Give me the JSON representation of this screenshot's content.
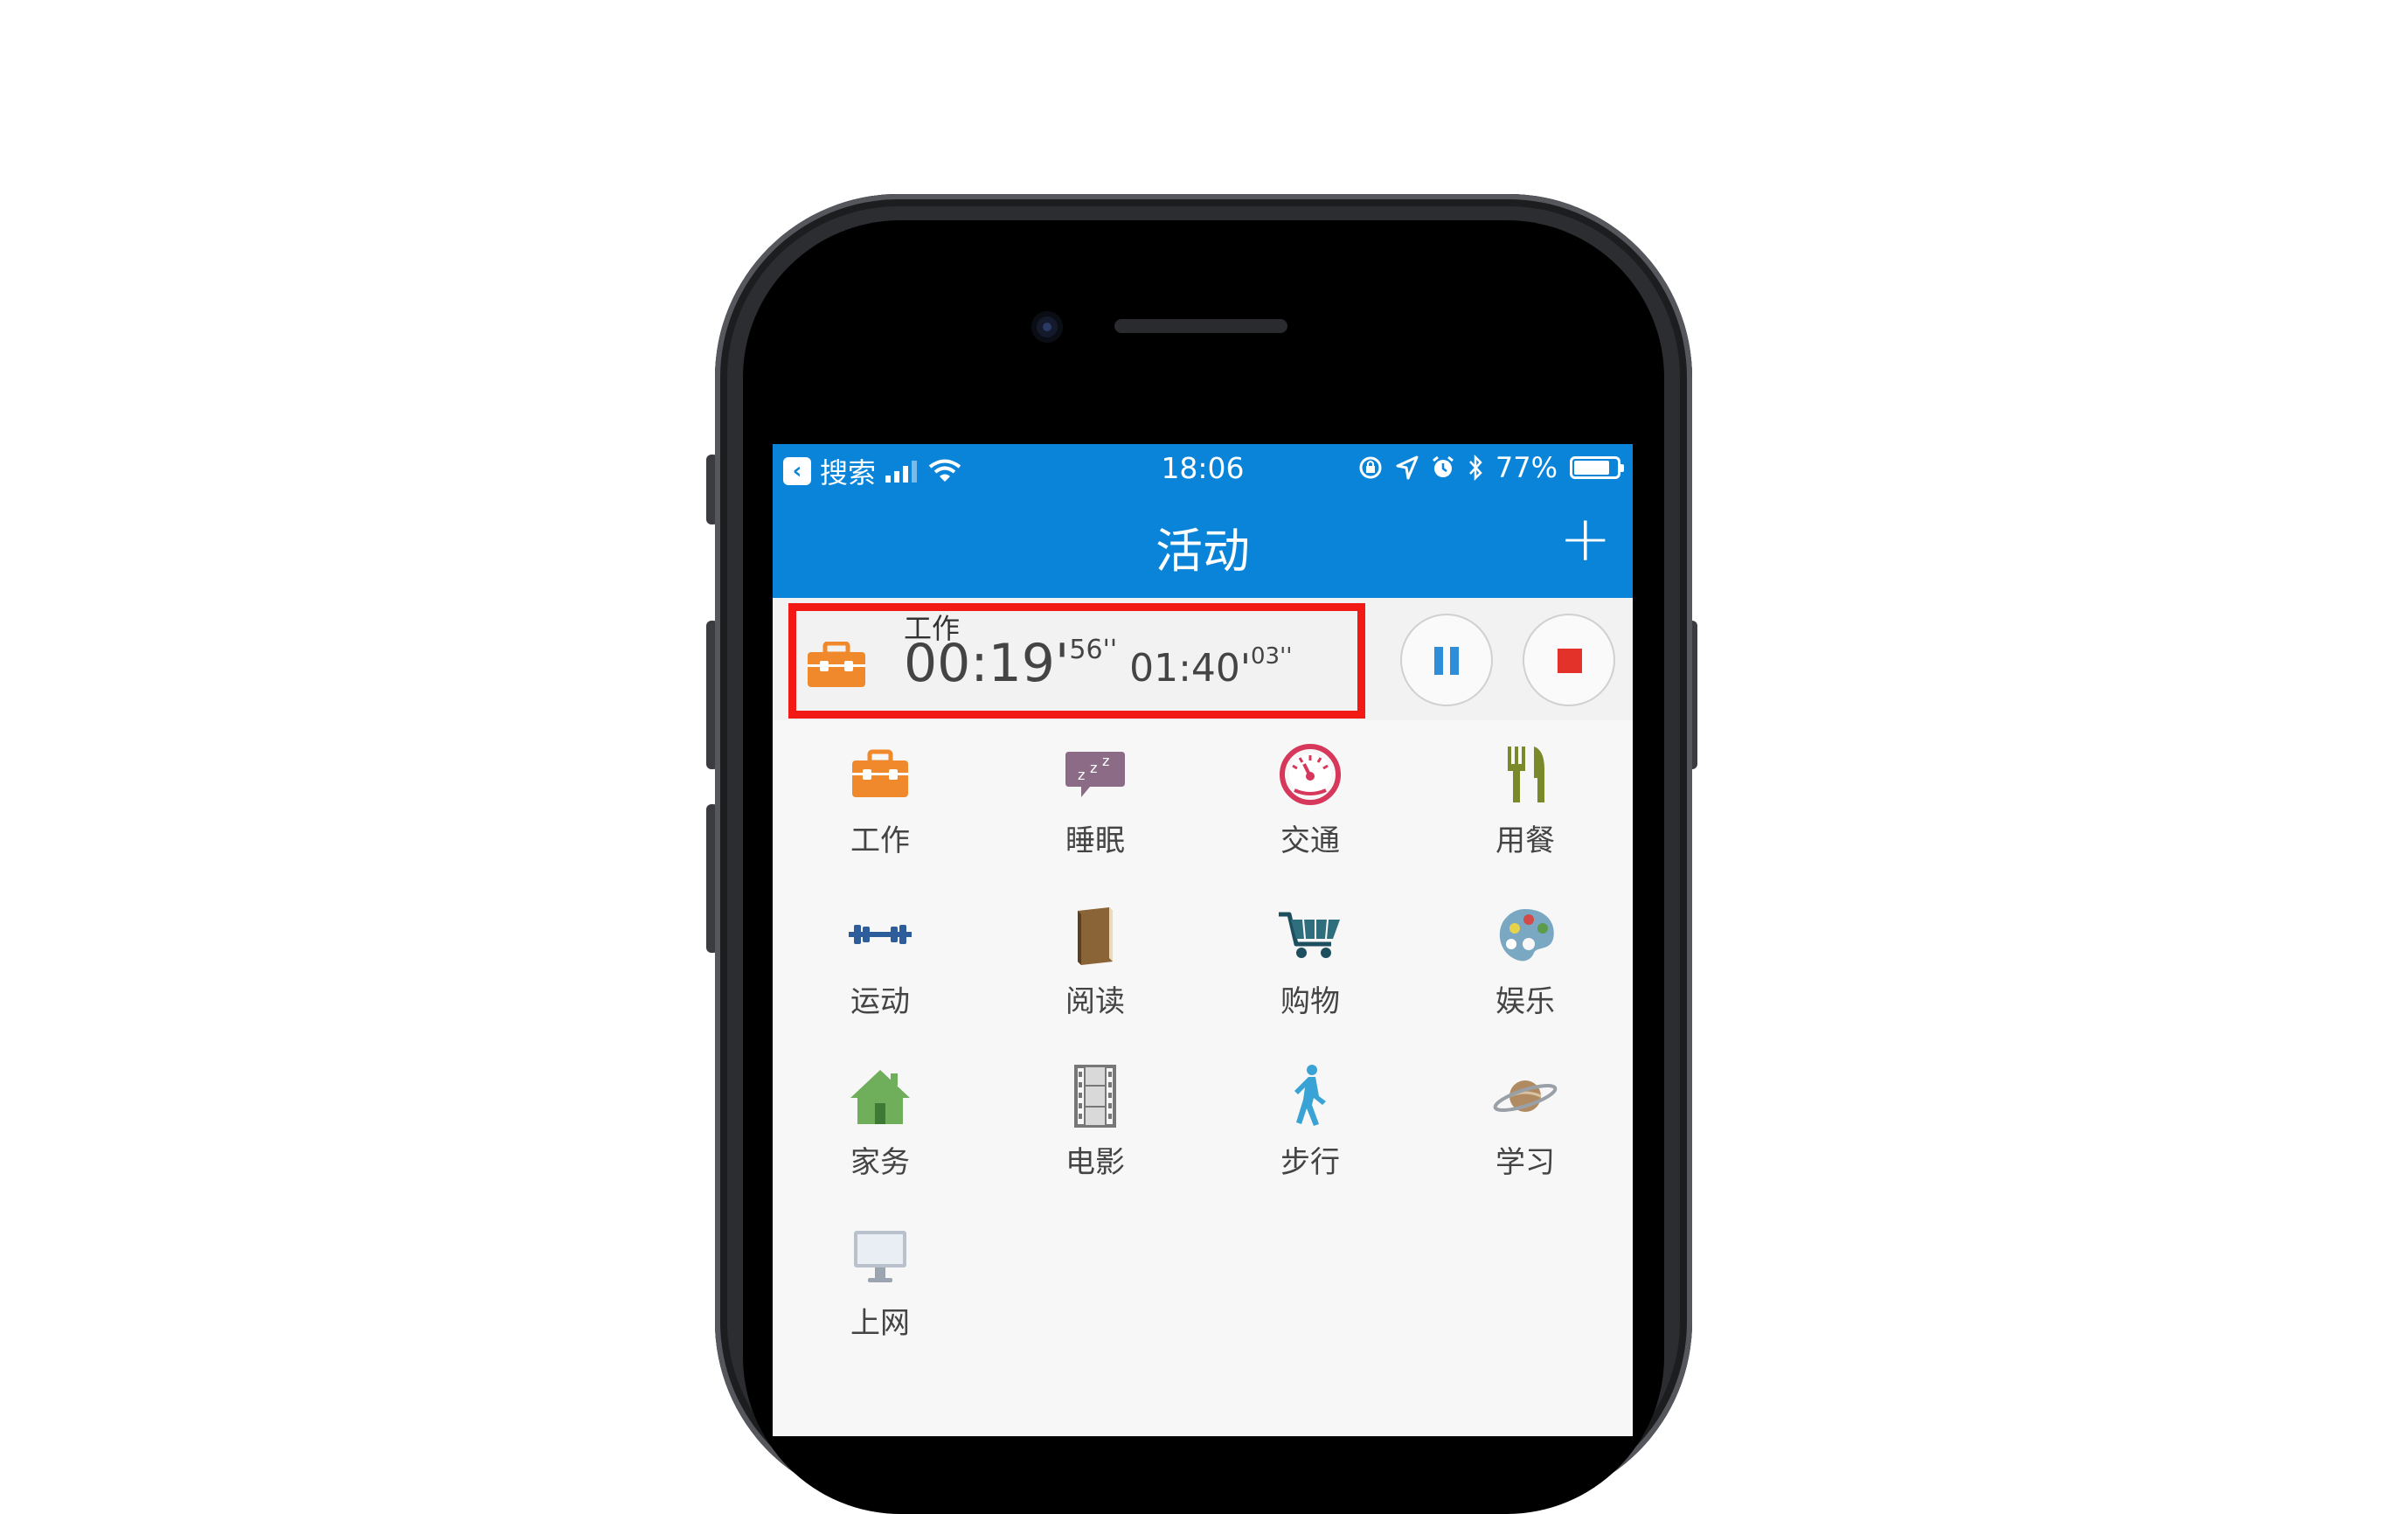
{
  "status_bar": {
    "back_app": "搜索",
    "time": "18:06",
    "battery_percent": "77%",
    "battery_level": 0.77
  },
  "nav": {
    "title": "活动",
    "add_label": "+"
  },
  "current_activity": {
    "name": "工作",
    "elapsed_main": "00:19'",
    "elapsed_seconds": "56''",
    "total_main": "01:40'",
    "total_seconds": "03''"
  },
  "activities": [
    {
      "label": "工作",
      "icon": "briefcase-icon"
    },
    {
      "label": "睡眠",
      "icon": "sleep-bubble-icon"
    },
    {
      "label": "交通",
      "icon": "speedometer-icon"
    },
    {
      "label": "用餐",
      "icon": "fork-knife-icon"
    },
    {
      "label": "运动",
      "icon": "dumbbell-icon"
    },
    {
      "label": "阅读",
      "icon": "book-icon"
    },
    {
      "label": "购物",
      "icon": "cart-icon"
    },
    {
      "label": "娱乐",
      "icon": "palette-icon"
    },
    {
      "label": "家务",
      "icon": "house-icon"
    },
    {
      "label": "电影",
      "icon": "film-icon"
    },
    {
      "label": "步行",
      "icon": "walking-icon"
    },
    {
      "label": "学习",
      "icon": "planet-icon"
    },
    {
      "label": "上网",
      "icon": "monitor-icon"
    }
  ],
  "colors": {
    "header": "#0a84d8",
    "highlight": "#f21a14",
    "accent_orange": "#f0892b"
  }
}
